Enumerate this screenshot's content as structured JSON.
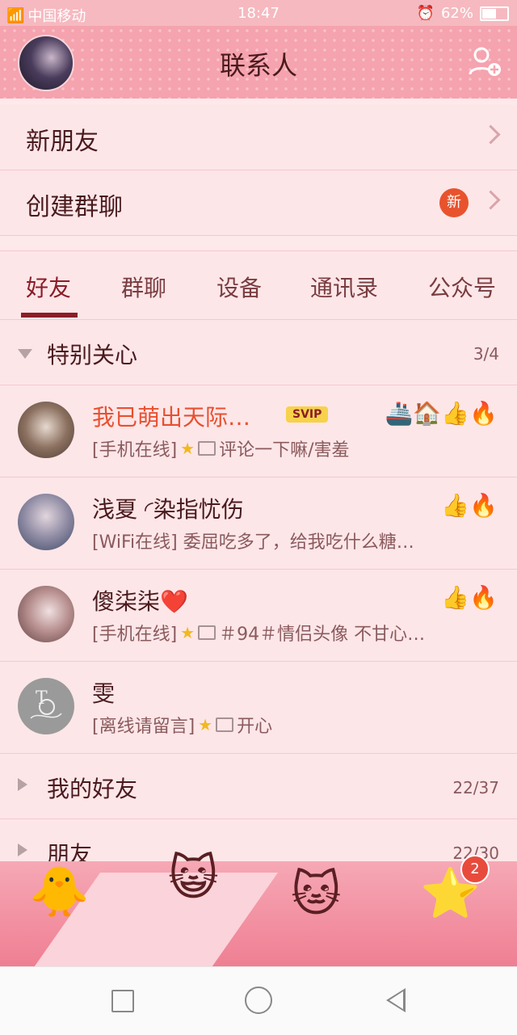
{
  "status_bar": {
    "carrier": "中国移动",
    "network": "4G",
    "time": "18:47",
    "battery": "62%",
    "battery_level": 0.62
  },
  "header": {
    "title": "联系人"
  },
  "quick_rows": [
    {
      "label": "新朋友"
    },
    {
      "label": "创建群聊",
      "badge": "新"
    }
  ],
  "tabs": [
    "好友",
    "群聊",
    "设备",
    "通讯录",
    "公众号"
  ],
  "groups": {
    "special": {
      "label": "特别关心",
      "count": "3/4"
    },
    "my_friends": {
      "label": "我的好友",
      "count": "22/37"
    },
    "friends": {
      "label": "朋友",
      "count": "22/30"
    }
  },
  "friends": [
    {
      "name": "我已萌出天际…",
      "status": "[手机在线]",
      "signature": "评论一下嘛/害羞",
      "badge": "SVIP",
      "icons": "🚢🏠👍🔥"
    },
    {
      "name": "浅夏   ◜染指忧伤",
      "status": "[WiFi在线] 委屈吃多了，给我吃什么糖…",
      "signature": "",
      "icons": "👍🔥"
    },
    {
      "name": "傻柒柒❤️",
      "status": "[手机在线]",
      "signature": "＃94＃情侣头像 不甘心…",
      "icons": "👍🔥"
    },
    {
      "name": "雯",
      "status": "[离线请留言]",
      "signature": "开心"
    }
  ],
  "bottom": {
    "badge_count": "2"
  },
  "colors": {
    "accent": "#8b1d27",
    "header_bg": "#f5a3ae",
    "row_bg": "#fde6e8"
  }
}
